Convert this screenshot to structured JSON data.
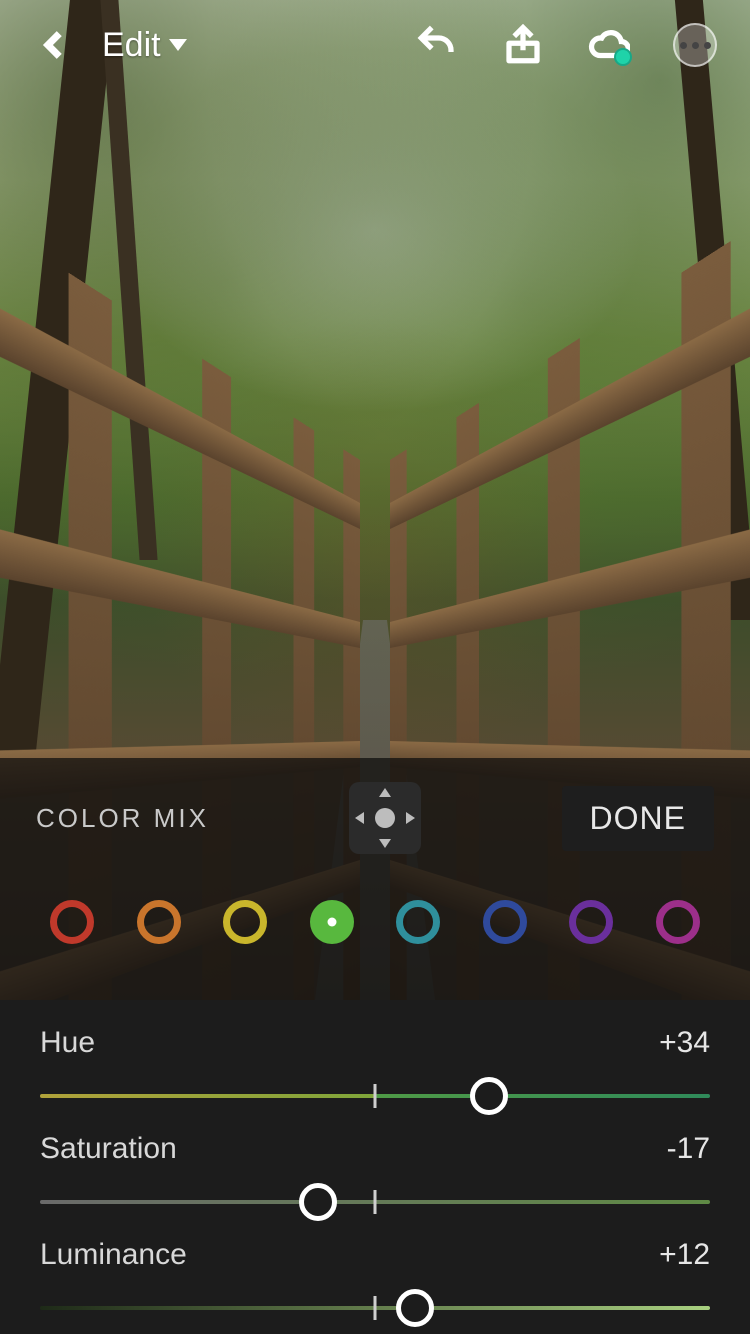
{
  "header": {
    "mode_label": "Edit",
    "icons": {
      "back": "chevron-left-icon",
      "undo": "undo-icon",
      "share": "share-icon",
      "cloud": "cloud-sync-icon",
      "more": "more-icon"
    }
  },
  "color_mix": {
    "title": "COLOR MIX",
    "done_label": "DONE",
    "target_tool": "targeted-adjustment-icon",
    "swatches": [
      {
        "name": "red",
        "color": "#c0392b",
        "selected": false
      },
      {
        "name": "orange",
        "color": "#c9752c",
        "selected": false
      },
      {
        "name": "yellow",
        "color": "#c9b62c",
        "selected": false
      },
      {
        "name": "green",
        "color": "#58b83e",
        "selected": true
      },
      {
        "name": "aqua",
        "color": "#2f8f9c",
        "selected": false
      },
      {
        "name": "blue",
        "color": "#2f4a9c",
        "selected": false
      },
      {
        "name": "purple",
        "color": "#6a2f9c",
        "selected": false
      },
      {
        "name": "magenta",
        "color": "#9c2f8a",
        "selected": false
      }
    ]
  },
  "sliders": {
    "hue": {
      "label": "Hue",
      "value_text": "+34",
      "value": 34,
      "min": -100,
      "max": 100
    },
    "saturation": {
      "label": "Saturation",
      "value_text": "-17",
      "value": -17,
      "min": -100,
      "max": 100
    },
    "luminance": {
      "label": "Luminance",
      "value_text": "+12",
      "value": 12,
      "min": -100,
      "max": 100
    }
  }
}
